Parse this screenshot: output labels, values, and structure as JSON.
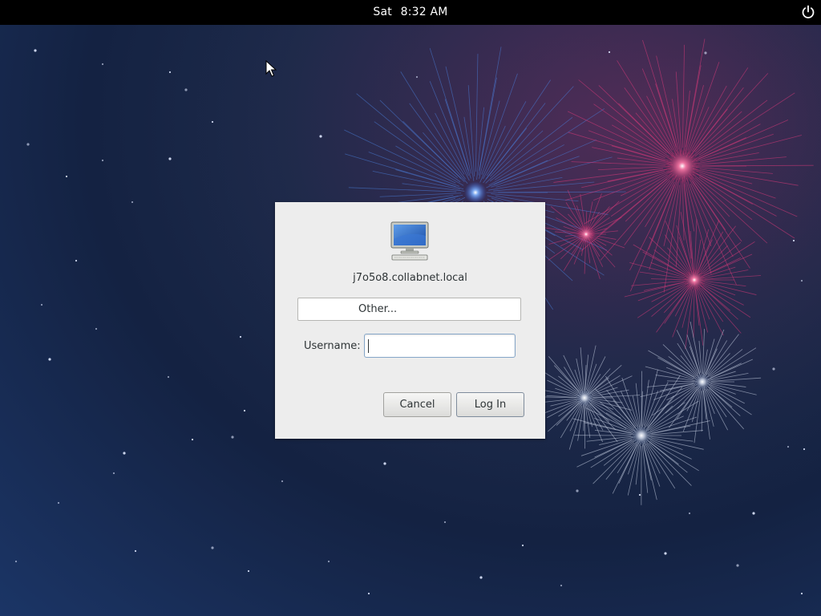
{
  "topbar": {
    "day": "Sat",
    "time": "8:32 AM",
    "power_icon": "power-icon"
  },
  "login_dialog": {
    "host_icon": "computer-icon",
    "hostname": "j7o5o8.collabnet.local",
    "other_label": "Other...",
    "username_label": "Username:",
    "username_value": "",
    "cancel_label": "Cancel",
    "login_label": "Log In"
  },
  "wallpaper": {
    "theme": "fireworks",
    "colors": {
      "background": "#1d2a4a",
      "blue_burst": "#4a7fdc",
      "pink_burst": "#e23a7c",
      "white_burst": "#cfd8ea"
    }
  },
  "pointer": {
    "icon": "mouse-pointer-icon"
  }
}
